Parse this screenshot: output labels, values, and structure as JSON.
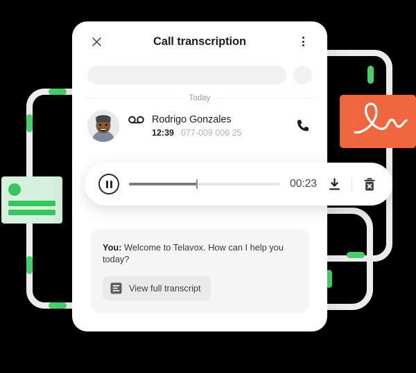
{
  "card": {
    "title": "Call transcription",
    "close_icon": "close-icon",
    "menu_icon": "more-vertical-icon"
  },
  "search": {
    "placeholder": ""
  },
  "divider": {
    "label": "Today"
  },
  "contact": {
    "name": "Rodrigo Gonzales",
    "time": "12:39",
    "phone": "077-009 006 25",
    "voicemail_icon": "voicemail-icon",
    "call_icon": "phone-icon",
    "avatar_alt": "avatar"
  },
  "player": {
    "state": "playing",
    "play_icon": "pause-icon",
    "elapsed": "00:23",
    "progress_percent": 45,
    "download_icon": "download-icon",
    "delete_icon": "trash-x-icon"
  },
  "transcript": {
    "speaker": "You:",
    "message": " Welcome to Telavox. How can I help you today?",
    "button_label": "View full transcript",
    "button_icon": "document-lines-icon"
  },
  "decor": {
    "orange_card": "signature-scribble",
    "green_card": "contact-card-placeholder"
  },
  "colors": {
    "orange": "#f0673f",
    "green": "#38c45f",
    "green_light": "#d5f0dc",
    "frame_gray": "#ececec",
    "text_dark": "#1d1d1d",
    "text_muted": "#b3b3b3"
  }
}
